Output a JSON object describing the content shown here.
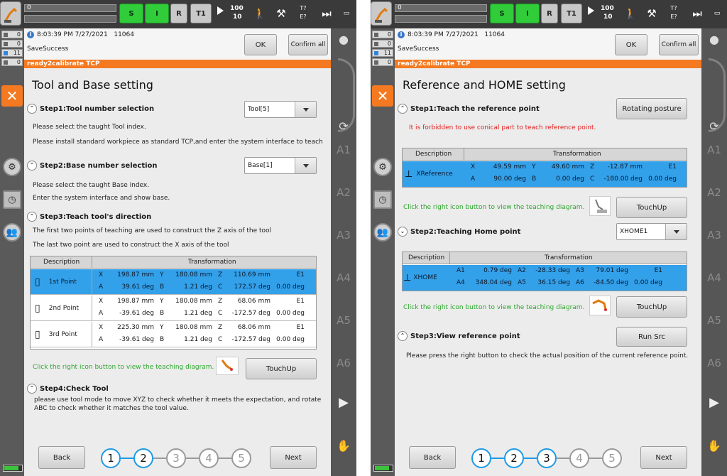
{
  "left": {
    "top": {
      "prog": "0",
      "speed_top": "100",
      "speed_bottom": "10",
      "btn_s": "S",
      "btn_i": "I",
      "btn_r": "R",
      "btn_t1": "T1",
      "tq_top": "T?",
      "tq_bot": "E?"
    },
    "status": {
      "time": "8:03:39 PM 7/27/2021",
      "code": "11064",
      "message": "SaveSuccess"
    },
    "ok_label": "OK",
    "confirm_label": "Confirm all",
    "banner": "ready2calibrate TCP",
    "title": "Tool and Base setting",
    "step1": {
      "title": "Step1:Tool number selection",
      "line1": "Please select the taught Tool index.",
      "line2": "Please install standard workpiece as standard TCP,and enter the system interface to teach",
      "dropdown": "Tool[5]"
    },
    "step2": {
      "title": "Step2:Base number selection",
      "line1": "Please select the taught Base index.",
      "line2": "Enter the system interface and show base.",
      "dropdown": "Base[1]"
    },
    "step3": {
      "title": "Step3:Teach tool's direction",
      "line1": "The first two points of teaching are used to construct the Z axis of the tool",
      "line2": "The last two point are used to construct the X axis of the tool"
    },
    "table": {
      "col_desc": "Description",
      "col_trans": "Transformation",
      "rows": [
        {
          "name": "1st Point",
          "r1": [
            "X",
            "198.87 mm",
            "Y",
            "180.08 mm",
            "Z",
            "110.69 mm",
            "E1"
          ],
          "r2": [
            "A",
            "39.61 deg",
            "B",
            "1.21 deg",
            "C",
            "172.57 deg",
            "0.00 deg"
          ]
        },
        {
          "name": "2nd Point",
          "r1": [
            "X",
            "198.87 mm",
            "Y",
            "180.08 mm",
            "Z",
            "68.06 mm",
            "E1"
          ],
          "r2": [
            "A",
            "-39.61 deg",
            "B",
            "1.21 deg",
            "C",
            "-172.57 deg",
            "0.00 deg"
          ]
        },
        {
          "name": "3rd Point",
          "r1": [
            "X",
            "225.30 mm",
            "Y",
            "180.08 mm",
            "Z",
            "68.06 mm",
            "E1"
          ],
          "r2": [
            "A",
            "-39.61 deg",
            "B",
            "1.21 deg",
            "C",
            "-172.57 deg",
            "0.00 deg"
          ]
        }
      ]
    },
    "hint": "Click the right icon button to view the teaching diagram.",
    "touchup": "TouchUp",
    "step4": {
      "title": "Step4:Check Tool",
      "line1": "please use tool mode to move XYZ to check whether it meets the expectation, and rotate",
      "line2": "ABC to check whether it matches the tool value."
    },
    "back": "Back",
    "next": "Next",
    "steps": [
      "1",
      "2",
      "3",
      "4",
      "5"
    ],
    "side_labels": [
      "A1",
      "A2",
      "A3",
      "A4",
      "A5",
      "A6"
    ]
  },
  "right": {
    "top": {
      "prog": "0",
      "speed_top": "100",
      "speed_bottom": "10",
      "btn_s": "S",
      "btn_i": "I",
      "btn_r": "R",
      "btn_t1": "T1",
      "tq_top": "T?",
      "tq_bot": "E?"
    },
    "status": {
      "time": "8:03:39 PM 7/27/2021",
      "code": "11064",
      "message": "SaveSuccess"
    },
    "ok_label": "OK",
    "confirm_label": "Confirm all",
    "banner": "ready2calibrate TCP",
    "title": "Reference and HOME setting",
    "step1": {
      "title": "Step1:Teach the reference point",
      "warning": "It is forbidden to use conical part to teach reference point.",
      "button": "Rotating posture"
    },
    "ref_table": {
      "col_desc": "Description",
      "col_trans": "Transformation",
      "name": "XReference",
      "r1": [
        "X",
        "49.59 mm",
        "Y",
        "49.60 mm",
        "Z",
        "-12.87 mm",
        "E1"
      ],
      "r2": [
        "A",
        "90.00 deg",
        "B",
        "0.00 deg",
        "C",
        "-180.00 deg",
        "0.00 deg"
      ]
    },
    "hint": "Click the right icon button to view the teaching diagram.",
    "touchup": "TouchUp",
    "step2": {
      "title": "Step2:Teaching Home point",
      "dropdown": "XHOME1"
    },
    "home_table": {
      "col_desc": "Description",
      "col_trans": "Transformation",
      "name": "XHOME",
      "r1": [
        "A1",
        "0.79 deg",
        "A2",
        "-28.33 deg",
        "A3",
        "79.01 deg",
        "E1"
      ],
      "r2": [
        "A4",
        "348.04 deg",
        "A5",
        "36.15 deg",
        "A6",
        "-84.50 deg",
        "0.00 deg"
      ]
    },
    "step3": {
      "title": "Step3:View reference point",
      "line1": "Please press the right button to check the actual position of the current reference point.",
      "button": "Run Src"
    },
    "back": "Back",
    "next": "Next",
    "steps": [
      "1",
      "2",
      "3",
      "4",
      "5"
    ],
    "side_labels": [
      "A1",
      "A2",
      "A3",
      "A4",
      "A5",
      "A6"
    ]
  }
}
